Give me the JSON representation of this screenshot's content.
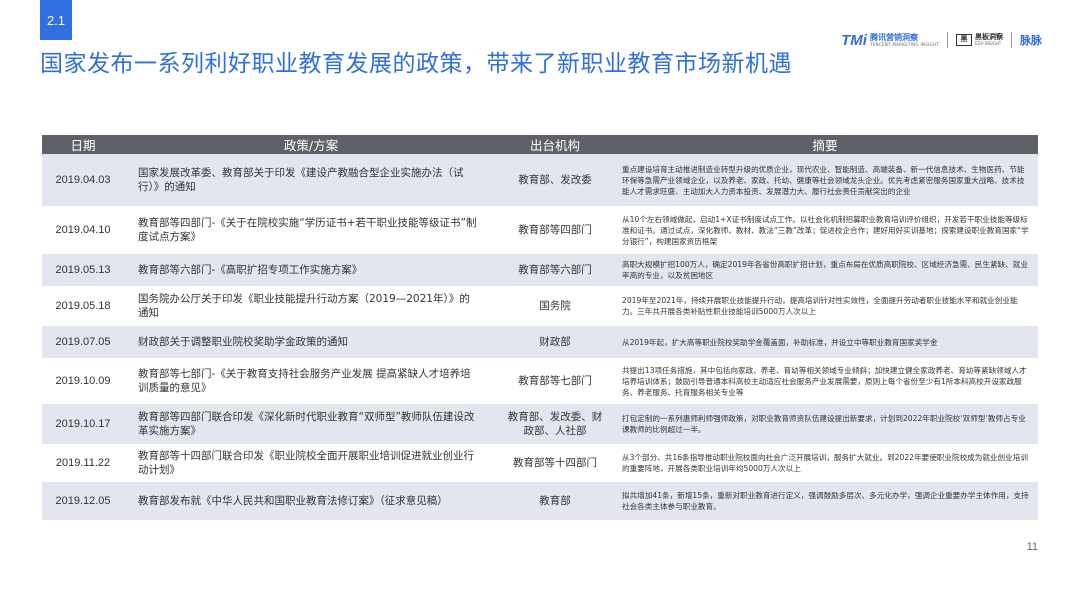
{
  "section": "2.1",
  "title": "国家发布一系列利好职业教育发展的政策，带来了新职业教育市场新机遇",
  "logos": {
    "brand_a_mark": "TMi",
    "brand_a_cn": "腾讯营销洞察",
    "brand_a_en": "TENCENT MARKETING INSIGHT",
    "brand_b_mark": "黑",
    "brand_b_cn": "黑板洞察",
    "brand_b_en": "EDU INSIGHT",
    "brand_c": "脉脉"
  },
  "table": {
    "headers": [
      "日期",
      "政策/方案",
      "出台机构",
      "摘要"
    ],
    "rows": [
      {
        "date": "2019.04.03",
        "policy": "国家发展改革委、教育部关于印发《建设产教融合型企业实施办法（试行）》的通知",
        "org": "教育部、发改委",
        "summary": "重点建设培育主动推进制造业转型升级的优质企业，现代农业、智能制造、高端装备、新一代信息技术、生物医药、节能环保等急需产业领域企业，以及养老、家政、托幼、健康等社会领域龙头企业。优先考虑紧密服务国家重大战略、技术技能人才需求旺盛、主动加大人力资本投资、发展潜力大、履行社会责任贡献突出的企业"
      },
      {
        "date": "2019.04.10",
        "policy": "教育部等四部门-《关于在院校实施“学历证书+若干职业技能等级证书”制度试点方案》",
        "org": "教育部等四部门",
        "summary": "从10个左右领域做起，启动1+X证书制度试点工作。以社会化机制招募职业教育培训评价组织，开发若干职业技能等级标准和证书。通过试点，深化教师、教材、教法“三教”改革；促进校企合作；建好用好实训基地；探索建设职业教育国家“学分银行”，构建国家资历框架"
      },
      {
        "date": "2019.05.13",
        "policy": "教育部等六部门-《高职扩招专项工作实施方案》",
        "org": "教育部等六部门",
        "summary": "高职大规模扩招100万人，确定2019年各省份高职扩招计划，重点布局在优质高职院校、区域经济急需、民生紧缺、就业率高的专业，以及贫困地区"
      },
      {
        "date": "2019.05.18",
        "policy": "国务院办公厅关于印发《职业技能提升行动方案（2019—2021年）》的通知",
        "org": "国务院",
        "summary": "2019年至2021年，持续开展职业技能提升行动，提高培训针对性实效性，全面提升劳动者职业技能水平和就业创业能力。三年共开展各类补贴性职业技能培训5000万人次以上"
      },
      {
        "date": "2019.07.05",
        "policy": "财政部关于调整职业院校奖助学金政策的通知",
        "org": "财政部",
        "summary": "从2019年起，扩大高等职业院校奖助学金覆盖面，补助标准，并设立中等职业教育国家奖学金"
      },
      {
        "date": "2019.10.09",
        "policy": "教育部等七部门-《关于教育支持社会服务产业发展 提高紧缺人才培养培训质量的意见》",
        "org": "教育部等七部门",
        "summary": "共提出13项任务措施，其中包括向家政、养老、育幼等相关领域专业倾斜；加快建立健全家政养老、育幼等紧缺领域人才培养培训体系；鼓励引导普通本科高校主动适应社会服务产业发展需要，原则上每个省份至少有1所本科高校开设家政服务、养老服务、托育服务相关专业等"
      },
      {
        "date": "2019.10.17",
        "policy": "教育部等四部门联合印发《深化新时代职业教育“双师型”教师队伍建设改革实施方案》",
        "org": "教育部、发改委、财政部、人社部",
        "summary": "打包定制的一系列惠师利师强师政策，对职业教育师资队伍建设提出新要求，计划到2022年职业院校‘双师型’教师占专业课教师的比例超过一半。"
      },
      {
        "date": "2019.11.22",
        "policy": "教育部等十四部门联合印发《职业院校全面开展职业培训促进就业创业行动计划》",
        "org": "教育部等十四部门",
        "summary": "从3个部分、共16条指导推动职业院校面向社会广泛开展培训，服务扩大就业。到2022年要使职业院校成为就业创业培训的重要阵地，开展各类职业培训年均5000万人次以上"
      },
      {
        "date": "2019.12.05",
        "policy": "教育部发布就《中华人民共和国职业教育法修订案》（征求意见稿）",
        "org": "教育部",
        "summary": "拟共增加41条，新增15条，重新对职业教育进行定义，强调鼓励多层次、多元化办学，强调企业重要办学主体作用，支持社会各类主体参与职业教育。"
      }
    ]
  },
  "page_number": "11"
}
